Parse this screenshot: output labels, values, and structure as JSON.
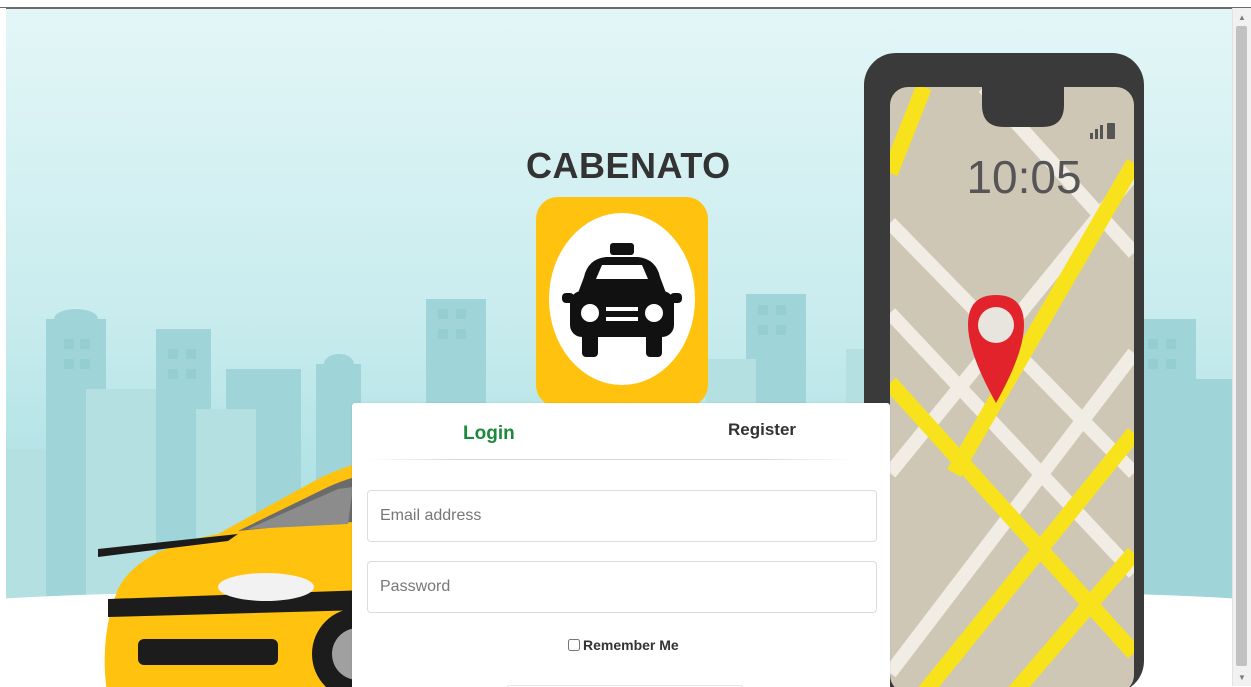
{
  "app": {
    "brand_name": "CABENATO"
  },
  "phone": {
    "clock": "10:05"
  },
  "auth": {
    "tabs": [
      {
        "label": "Login",
        "active": true
      },
      {
        "label": "Register",
        "active": false
      }
    ],
    "email_placeholder": "Email address",
    "password_placeholder": "Password",
    "remember_label": "Remember Me",
    "remember_checked": false
  },
  "colors": {
    "accent_green": "#1b8a3a",
    "taxi_yellow": "#ffc20e",
    "map_yellow": "#f7e21c",
    "pin_red": "#e2232b",
    "sky": "#c9ecee"
  },
  "icons": [
    "taxi-icon",
    "map-pin-icon",
    "signal-icon",
    "battery-icon"
  ]
}
